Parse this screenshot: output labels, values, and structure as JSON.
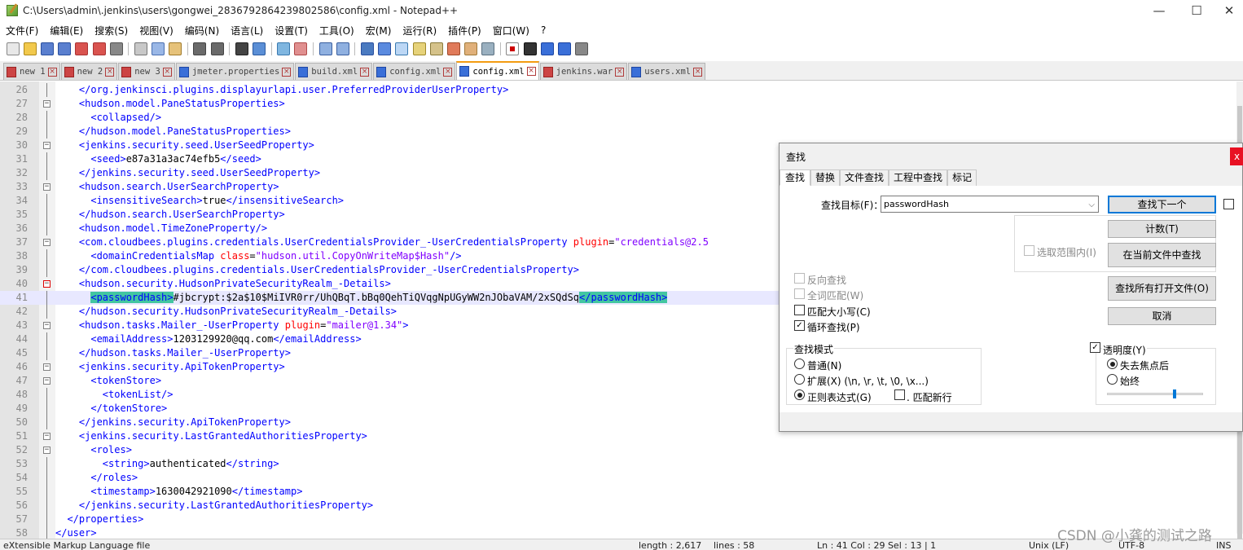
{
  "window": {
    "title": "C:\\Users\\admin\\.jenkins\\users\\gongwei_2836792864239802586\\config.xml - Notepad++",
    "minimize": "—",
    "maximize": "☐",
    "close": "✕"
  },
  "menu": [
    "文件(F)",
    "编辑(E)",
    "搜索(S)",
    "视图(V)",
    "编码(N)",
    "语言(L)",
    "设置(T)",
    "工具(O)",
    "宏(M)",
    "运行(R)",
    "插件(P)",
    "窗口(W)",
    "?"
  ],
  "tabs": [
    {
      "label": "new 1",
      "icon": "red"
    },
    {
      "label": "new 2",
      "icon": "red"
    },
    {
      "label": "new 3",
      "icon": "red"
    },
    {
      "label": "jmeter.properties",
      "icon": "blue"
    },
    {
      "label": "build.xml",
      "icon": "blue"
    },
    {
      "label": "config.xml",
      "icon": "blue"
    },
    {
      "label": "config.xml",
      "icon": "blue",
      "active": true
    },
    {
      "label": "jenkins.war",
      "icon": "red"
    },
    {
      "label": "users.xml",
      "icon": "blue"
    }
  ],
  "editor": {
    "current_line": 41,
    "lines": [
      {
        "n": "26",
        "segs": [
          [
            "t",
            "    </org.jenkinsci.plugins.displayurlapi.user.PreferredProviderUserProperty>"
          ]
        ]
      },
      {
        "n": "27",
        "fold": "−",
        "segs": [
          [
            "t",
            "    <hudson.model.PaneStatusProperties>"
          ]
        ]
      },
      {
        "n": "28",
        "segs": [
          [
            "t",
            "      <collapsed/>"
          ]
        ]
      },
      {
        "n": "29",
        "segs": [
          [
            "t",
            "    </hudson.model.PaneStatusProperties>"
          ]
        ]
      },
      {
        "n": "30",
        "fold": "−",
        "segs": [
          [
            "t",
            "    <jenkins.security.seed.UserSeedProperty>"
          ]
        ]
      },
      {
        "n": "31",
        "segs": [
          [
            "t",
            "      <seed>"
          ],
          [
            "x",
            "e87a31a3ac74efb5"
          ],
          [
            "t",
            "</seed>"
          ]
        ]
      },
      {
        "n": "32",
        "segs": [
          [
            "t",
            "    </jenkins.security.seed.UserSeedProperty>"
          ]
        ]
      },
      {
        "n": "33",
        "fold": "−",
        "segs": [
          [
            "t",
            "    <hudson.search.UserSearchProperty>"
          ]
        ]
      },
      {
        "n": "34",
        "segs": [
          [
            "t",
            "      <insensitiveSearch>"
          ],
          [
            "x",
            "true"
          ],
          [
            "t",
            "</insensitiveSearch>"
          ]
        ]
      },
      {
        "n": "35",
        "segs": [
          [
            "t",
            "    </hudson.search.UserSearchProperty>"
          ]
        ]
      },
      {
        "n": "36",
        "segs": [
          [
            "t",
            "    <hudson.model.TimeZoneProperty/>"
          ]
        ]
      },
      {
        "n": "37",
        "fold": "−",
        "segs": [
          [
            "t",
            "    <com.cloudbees.plugins.credentials.UserCredentialsProvider_-UserCredentialsProperty "
          ],
          [
            "a",
            "plugin"
          ],
          [
            "x",
            "="
          ],
          [
            "v",
            "\"credentials@2.5"
          ]
        ]
      },
      {
        "n": "38",
        "segs": [
          [
            "t",
            "      <domainCredentialsMap "
          ],
          [
            "a",
            "class"
          ],
          [
            "x",
            "="
          ],
          [
            "v",
            "\"hudson.util.CopyOnWriteMap$Hash\""
          ],
          [
            "t",
            "/>"
          ]
        ]
      },
      {
        "n": "39",
        "segs": [
          [
            "t",
            "    </com.cloudbees.plugins.credentials.UserCredentialsProvider_-UserCredentialsProperty>"
          ]
        ]
      },
      {
        "n": "40",
        "fold": "−",
        "foldred": true,
        "segs": [
          [
            "t",
            "    <hudson.security.HudsonPrivateSecurityRealm_-Details>"
          ]
        ]
      },
      {
        "n": "41",
        "segs": [
          [
            "x",
            "      "
          ],
          [
            "hl",
            "<passwordHash>"
          ],
          [
            "x",
            "#jbcrypt:$2a$10$MiIVR0rr/UhQBqT.bBq0QehTiQVqgNpUGyWW2nJObaVAM/2xSQdSq"
          ],
          [
            "hl",
            "</passwordHash>"
          ]
        ]
      },
      {
        "n": "42",
        "segs": [
          [
            "t",
            "    </hudson.security.HudsonPrivateSecurityRealm_-Details>"
          ]
        ]
      },
      {
        "n": "43",
        "fold": "−",
        "segs": [
          [
            "t",
            "    <hudson.tasks.Mailer_-UserProperty "
          ],
          [
            "a",
            "plugin"
          ],
          [
            "x",
            "="
          ],
          [
            "v",
            "\"mailer@1.34\""
          ],
          [
            "t",
            ">"
          ]
        ]
      },
      {
        "n": "44",
        "segs": [
          [
            "t",
            "      <emailAddress>"
          ],
          [
            "x",
            "1203129920@qq.com"
          ],
          [
            "t",
            "</emailAddress>"
          ]
        ]
      },
      {
        "n": "45",
        "segs": [
          [
            "t",
            "    </hudson.tasks.Mailer_-UserProperty>"
          ]
        ]
      },
      {
        "n": "46",
        "fold": "−",
        "segs": [
          [
            "t",
            "    <jenkins.security.ApiTokenProperty>"
          ]
        ]
      },
      {
        "n": "47",
        "fold": "−",
        "segs": [
          [
            "t",
            "      <tokenStore>"
          ]
        ]
      },
      {
        "n": "48",
        "segs": [
          [
            "t",
            "        <tokenList/>"
          ]
        ]
      },
      {
        "n": "49",
        "segs": [
          [
            "t",
            "      </tokenStore>"
          ]
        ]
      },
      {
        "n": "50",
        "segs": [
          [
            "t",
            "    </jenkins.security.ApiTokenProperty>"
          ]
        ]
      },
      {
        "n": "51",
        "fold": "−",
        "segs": [
          [
            "t",
            "    <jenkins.security.LastGrantedAuthoritiesProperty>"
          ]
        ]
      },
      {
        "n": "52",
        "fold": "−",
        "segs": [
          [
            "t",
            "      <roles>"
          ]
        ]
      },
      {
        "n": "53",
        "segs": [
          [
            "t",
            "        <string>"
          ],
          [
            "x",
            "authenticated"
          ],
          [
            "t",
            "</string>"
          ]
        ]
      },
      {
        "n": "54",
        "segs": [
          [
            "t",
            "      </roles>"
          ]
        ]
      },
      {
        "n": "55",
        "segs": [
          [
            "t",
            "      <timestamp>"
          ],
          [
            "x",
            "1630042921090"
          ],
          [
            "t",
            "</timestamp>"
          ]
        ]
      },
      {
        "n": "56",
        "segs": [
          [
            "t",
            "    </jenkins.security.LastGrantedAuthoritiesProperty>"
          ]
        ]
      },
      {
        "n": "57",
        "segs": [
          [
            "t",
            "  </properties>"
          ]
        ]
      },
      {
        "n": "58",
        "segs": [
          [
            "t",
            "</user>"
          ]
        ]
      }
    ]
  },
  "statusbar": {
    "filetype": "eXtensible Markup Language file",
    "length": "length : 2,617",
    "lines": "lines : 58",
    "position": "Ln : 41    Col : 29    Sel : 13 | 1",
    "eol": "Unix (LF)",
    "encoding": "UTF-8",
    "mode": "INS"
  },
  "watermark": "CSDN @小龚的测试之路",
  "find_dialog": {
    "title": "查找",
    "close": "x",
    "tabs": [
      "查找",
      "替换",
      "文件查找",
      "工程中查找",
      "标记"
    ],
    "target_label": "查找目标(F)：",
    "target_value": "passwordHash",
    "btn_find_next": "查找下一个",
    "btn_count": "计数(T)",
    "btn_find_in_current": "在当前文件中查找",
    "btn_find_all_open": "查找所有打开文件(O)",
    "btn_cancel": "取消",
    "in_selection": "选取范围内(I)",
    "backward": "反向查找",
    "whole_word": "全词匹配(W)",
    "match_case": "匹配大小写(C)",
    "wrap_around": "循环查找(P)",
    "search_mode_label": "查找模式",
    "mode_normal": "普通(N)",
    "mode_extended": "扩展(X) (\\n, \\r, \\t, \\0, \\x...)",
    "mode_regex": "正则表达式(G)",
    "dot_newline": ". 匹配新行",
    "transparency": "透明度(Y)",
    "on_lose_focus": "失去焦点后",
    "always": "始终",
    "transparency_level": 0.7
  }
}
